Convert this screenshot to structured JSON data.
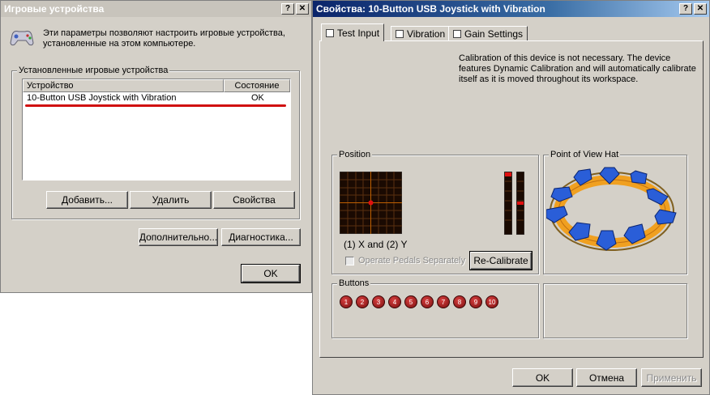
{
  "left_window": {
    "title": "Игровые устройства",
    "help_btn": "?",
    "close_btn": "✕",
    "intro_line1": "Эти параметры позволяют настроить игровые устройства,",
    "intro_line2": "установленные на этом компьютере.",
    "group_label": "Установленные игровые устройства",
    "columns": [
      "Устройство",
      "Состояние"
    ],
    "rows": [
      {
        "device": "10-Button USB Joystick with Vibration",
        "status": "OK"
      }
    ],
    "add_button": "Добавить...",
    "remove_button": "Удалить",
    "properties_button": "Свойства",
    "advanced_button": "Дополнительно...",
    "diagnostics_button": "Диагностика...",
    "ok_button": "OK"
  },
  "right_window": {
    "title": "Свойства: 10-Button USB Joystick with Vibration",
    "help_btn": "?",
    "close_btn": "✕",
    "tabs": [
      "Test Input",
      "Vibration",
      "Gain Settings"
    ],
    "calibration_line1": "Calibration of this device is not necessary. The device",
    "calibration_line2": "features Dynamic Calibration and will automatically calibrate",
    "calibration_line3": "itself as it is moved throughout its workspace.",
    "position_label": "Position",
    "axes_label": "(1) X and (2) Y",
    "pedals_label": "Operate Pedals Separately",
    "recalibrate_button": "Re-Calibrate",
    "pov_label": "Point of View Hat",
    "buttons_label": "Buttons",
    "button_numbers": [
      "1",
      "2",
      "3",
      "4",
      "5",
      "6",
      "7",
      "8",
      "9",
      "10"
    ],
    "ok_button": "OK",
    "cancel_button": "Отмена",
    "apply_button": "Применить"
  },
  "colors": {
    "accent_red": "#d01010",
    "crosshair": "#c06000",
    "arrow_blue": "#2a5ed8",
    "ring_orange": "#f0a020"
  }
}
